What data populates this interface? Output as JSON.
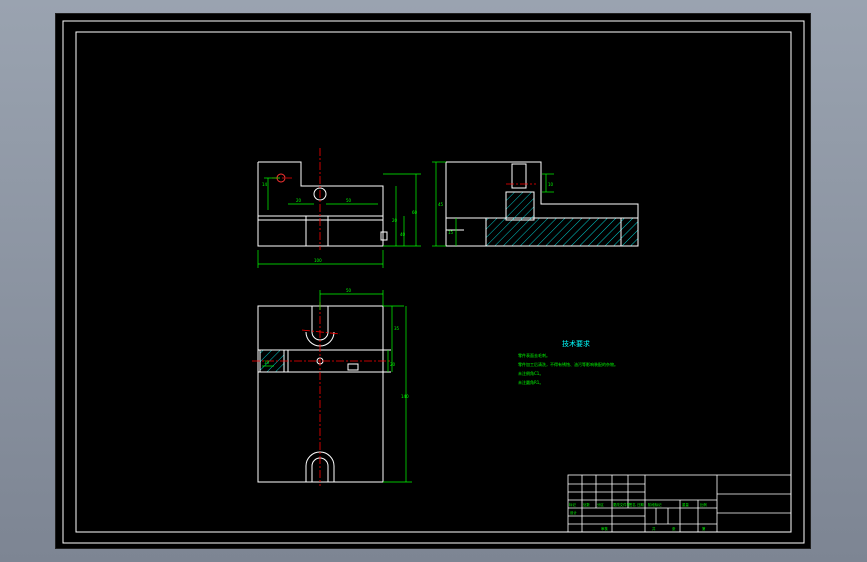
{
  "colors": {
    "background": "#000000",
    "outline": "#ffffff",
    "dimension": "#00ff00",
    "centerline": "#ff0000",
    "hatch": "#00ffff",
    "note_title": "#00ffff",
    "note_text": "#00ff00"
  },
  "front_view": {
    "dims": {
      "hole_offset": "14",
      "left_width": "20",
      "right_width": "50",
      "overall_width": "100",
      "height_top": "20",
      "height_mid": "40",
      "height_total": "60"
    }
  },
  "side_view": {
    "dims": {
      "slot_depth": "10",
      "height_total": "45",
      "height_lower": "15"
    }
  },
  "top_view": {
    "dims": {
      "slot_width": "50",
      "top_offset": "35",
      "slot_height": "20",
      "left_small": "10",
      "overall_length": "140"
    }
  },
  "technical_requirements": {
    "title": "技术要求",
    "lines": [
      "零件表面去毛刺。",
      "零件加工后清洗，不得有锈蚀、油污等影响装配的杂物。",
      "未注倒角C1。",
      "未注圆角R1。"
    ]
  },
  "title_block": {
    "labels": [
      "标记",
      "处数",
      "分区",
      "更改文件号",
      "签名",
      "日期",
      "阶段标记",
      "重量",
      "比例",
      "设计",
      "审核",
      "共",
      "张",
      "第"
    ]
  }
}
